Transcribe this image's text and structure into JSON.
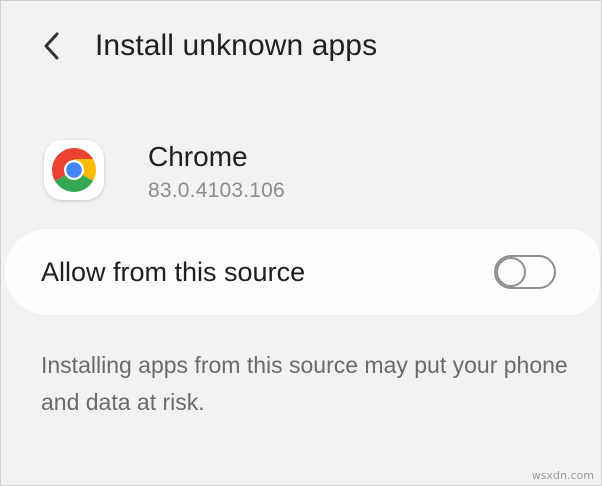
{
  "header": {
    "title": "Install unknown apps",
    "back_icon": "chevron-left-icon"
  },
  "app": {
    "name": "Chrome",
    "version": "83.0.4103.106",
    "icon": "chrome-logo-icon"
  },
  "setting": {
    "label": "Allow from this source",
    "toggle_state": "off"
  },
  "warning": {
    "text": "Installing apps from this source may put your phone and data at risk."
  },
  "watermark": "wsxdn.com",
  "colors": {
    "background": "#f2f2f2",
    "card": "#fcfcfc",
    "primary_text": "#202020",
    "secondary_text": "#8d8d8d",
    "toggle_outline": "#8e8e8e"
  }
}
